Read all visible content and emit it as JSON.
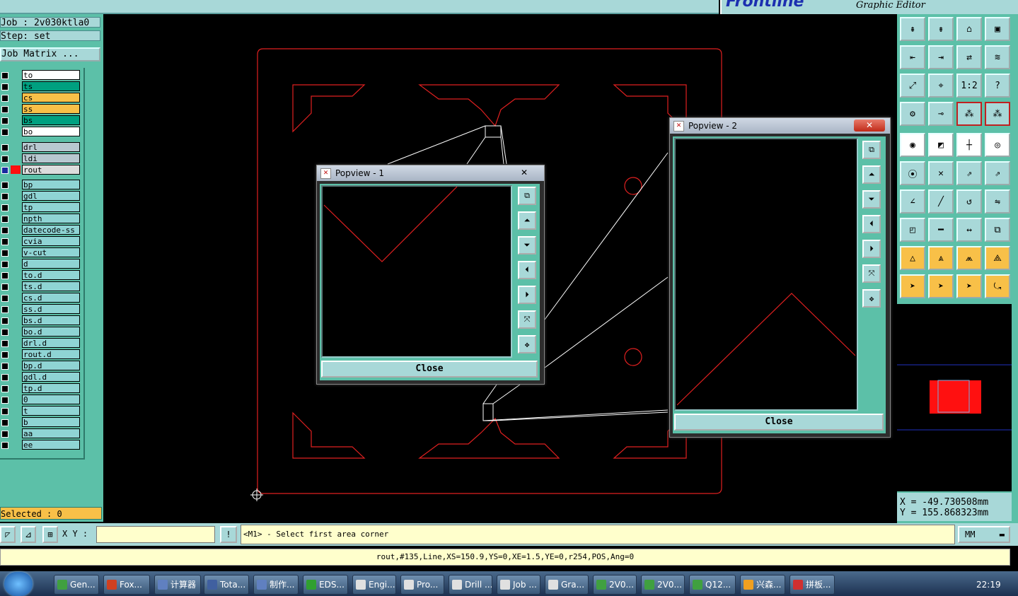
{
  "app": {
    "brand_title": "Graphic Editor",
    "brand_logo": "Frontline"
  },
  "info": {
    "job": "Job : 2v030ktla0",
    "step": "Step: set",
    "job_matrix": "Job Matrix ..."
  },
  "layers": [
    {
      "name": "to",
      "color": "#ffffff"
    },
    {
      "name": "ts",
      "color": "#00a080"
    },
    {
      "name": "cs",
      "color": "#f8c048"
    },
    {
      "name": "ss",
      "color": "#f8c048"
    },
    {
      "name": "bs",
      "color": "#00a080"
    },
    {
      "name": "bo",
      "color": "#ffffff"
    },
    {
      "name": "drl",
      "color": "#b8c8d0"
    },
    {
      "name": "ldi",
      "color": "#b8c8d0"
    },
    {
      "name": "rout",
      "color": "#dcdcdc",
      "active": true
    },
    {
      "name": "bp",
      "color": "#8fd4d4"
    },
    {
      "name": "gdl",
      "color": "#8fd4d4"
    },
    {
      "name": "tp",
      "color": "#8fd4d4"
    },
    {
      "name": "npth",
      "color": "#8fd4d4"
    },
    {
      "name": "datecode-ss",
      "color": "#8fd4d4"
    },
    {
      "name": "cvia",
      "color": "#8fd4d4"
    },
    {
      "name": "v-cut",
      "color": "#8fd4d4"
    },
    {
      "name": "d",
      "color": "#8fd4d4"
    },
    {
      "name": "to.d",
      "color": "#8fd4d4"
    },
    {
      "name": "ts.d",
      "color": "#8fd4d4"
    },
    {
      "name": "cs.d",
      "color": "#8fd4d4"
    },
    {
      "name": "ss.d",
      "color": "#8fd4d4"
    },
    {
      "name": "bs.d",
      "color": "#8fd4d4"
    },
    {
      "name": "bo.d",
      "color": "#8fd4d4"
    },
    {
      "name": "drl.d",
      "color": "#8fd4d4"
    },
    {
      "name": "rout.d",
      "color": "#8fd4d4"
    },
    {
      "name": "bp.d",
      "color": "#8fd4d4"
    },
    {
      "name": "gdl.d",
      "color": "#8fd4d4"
    },
    {
      "name": "tp.d",
      "color": "#8fd4d4"
    },
    {
      "name": "0",
      "color": "#8fd4d4"
    },
    {
      "name": "t",
      "color": "#8fd4d4"
    },
    {
      "name": "b",
      "color": "#8fd4d4"
    },
    {
      "name": "aa",
      "color": "#8fd4d4"
    },
    {
      "name": "ee",
      "color": "#8fd4d4"
    }
  ],
  "selected": "Selected : 0",
  "coords": {
    "x": "X  =  -49.730508mm",
    "y": "Y  =  155.868323mm"
  },
  "command": {
    "xy_label": "X Y :",
    "xy_value": "",
    "prompt": "<M1> - Select first area corner",
    "unit": "MM"
  },
  "status": "rout,#135,Line,XS=150.9,YS=0,XE=1.5,YE=0,r254,POS,Ang=0",
  "popview1": {
    "title": "Popview - 1",
    "close": "Close"
  },
  "popview2": {
    "title": "Popview - 2",
    "close": "Close"
  },
  "tool_labels": {
    "ratio": "1:2",
    "help": "?"
  },
  "taskbar": {
    "clock": "22:19",
    "tasks": [
      {
        "label": "Gen...",
        "color": "#40a040"
      },
      {
        "label": "Fox...",
        "color": "#d04020"
      },
      {
        "label": "计算器",
        "color": "#6080c0"
      },
      {
        "label": "Tota...",
        "color": "#4060a0"
      },
      {
        "label": "制作...",
        "color": "#6080c0"
      },
      {
        "label": "EDS...",
        "color": "#30a030"
      },
      {
        "label": "Engi...",
        "color": "#e0e0e0"
      },
      {
        "label": "Pro...",
        "color": "#e0e0e0"
      },
      {
        "label": "Drill ...",
        "color": "#e0e0e0"
      },
      {
        "label": "Job ...",
        "color": "#e0e0e0"
      },
      {
        "label": "Gra...",
        "color": "#e0e0e0"
      },
      {
        "label": "2V0...",
        "color": "#40a040"
      },
      {
        "label": "2V0...",
        "color": "#40a040"
      },
      {
        "label": "Q12...",
        "color": "#40a040"
      },
      {
        "label": "兴森...",
        "color": "#f0a020"
      },
      {
        "label": "拼板...",
        "color": "#d03030"
      }
    ]
  }
}
